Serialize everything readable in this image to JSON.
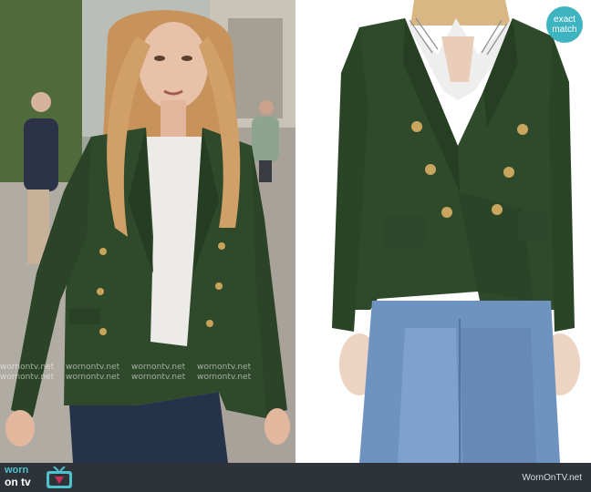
{
  "left_photo": {
    "alt": "Actress in green double-breasted blazer on city street",
    "watermark_text": "wornontv.net"
  },
  "right_photo": {
    "alt": "Product photo of green double-breasted blazer with gold buttons",
    "badge_line1": "exact",
    "badge_line2": "match"
  },
  "footer": {
    "brand_line1": "worn",
    "brand_line2": "on tv",
    "site_label": "WornOnTV.net"
  },
  "colors": {
    "blazer": "#2f4a2b",
    "badge": "#3fb4c1",
    "footer": "#2d3338"
  }
}
